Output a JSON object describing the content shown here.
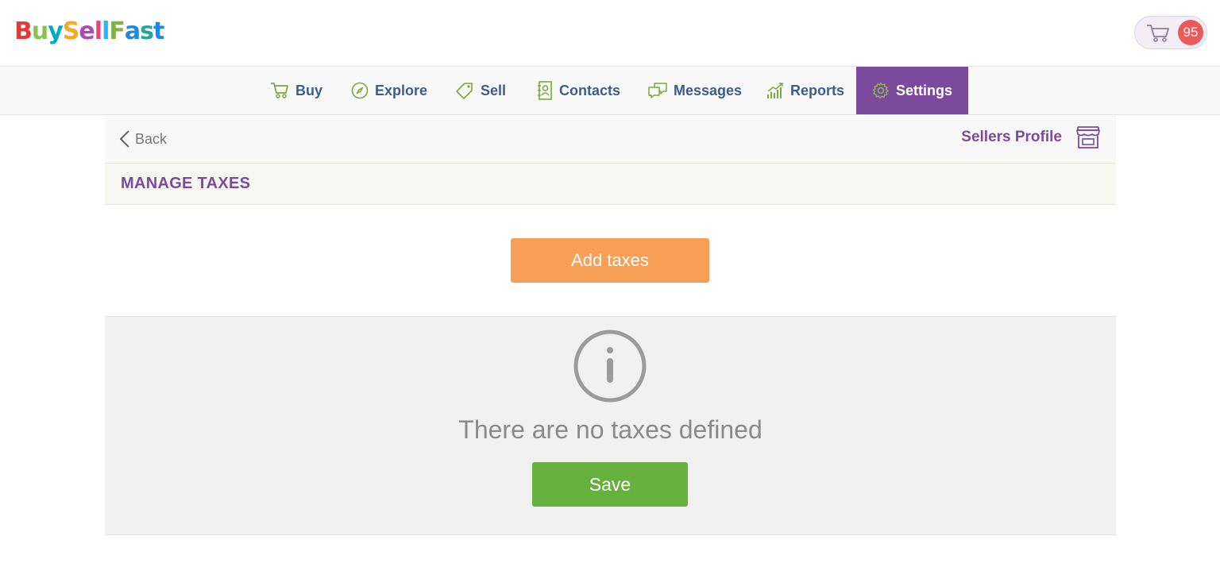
{
  "brand": {
    "logo_parts": [
      {
        "text": "B",
        "color": "#e53935"
      },
      {
        "text": "u",
        "color": "#8bc34a"
      },
      {
        "text": "y",
        "color": "#00acc1"
      },
      {
        "text": "S",
        "color": "#f9a825"
      },
      {
        "text": "e",
        "color": "#ab47bc"
      },
      {
        "text": "l",
        "color": "#ec407a"
      },
      {
        "text": "l",
        "color": "#29b6f6"
      },
      {
        "text": "F",
        "color": "#7cb342"
      },
      {
        "text": "a",
        "color": "#1e88e5"
      },
      {
        "text": "s",
        "color": "#26a69a"
      },
      {
        "text": "t",
        "color": "#1e88e5"
      }
    ]
  },
  "cart": {
    "count": "95",
    "icon": "cart-icon"
  },
  "nav": {
    "items": [
      {
        "label": "Buy",
        "icon": "cart-icon"
      },
      {
        "label": "Explore",
        "icon": "compass-icon"
      },
      {
        "label": "Sell",
        "icon": "tag-icon"
      },
      {
        "label": "Contacts",
        "icon": "contact-book-icon"
      },
      {
        "label": "Messages",
        "icon": "chat-icon"
      },
      {
        "label": "Reports",
        "icon": "chart-icon"
      },
      {
        "label": "Settings",
        "icon": "gear-icon",
        "active": true
      }
    ]
  },
  "subbar": {
    "back_label": "Back",
    "profile_label": "Sellers Profile"
  },
  "section": {
    "title": "MANAGE TAXES"
  },
  "actions": {
    "add_label": "Add taxes",
    "save_label": "Save"
  },
  "empty_state": {
    "message": "There are no taxes defined"
  },
  "colors": {
    "accent_purple": "#7c4a9c",
    "nav_text": "#3a5e8c",
    "add_button": "#f89f57",
    "save_button": "#66b13e",
    "badge": "#ea5a5a"
  }
}
